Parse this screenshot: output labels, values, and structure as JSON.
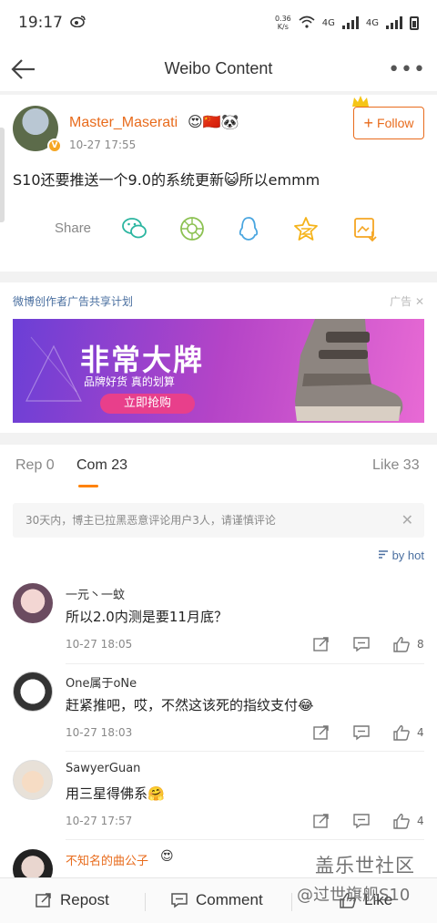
{
  "status_bar": {
    "time": "19:17",
    "speed_value": "0.36",
    "speed_unit": "K/s",
    "net_label_1": "4G",
    "net_label_2": "4G"
  },
  "header": {
    "title": "Weibo Content",
    "more": "•••"
  },
  "post": {
    "username": "Master_Maserati",
    "name_emojis": "😍🇨🇳🐼",
    "time": "10-27 17:55",
    "text": "S10还要推送一个9.0的系统更新😺所以emmm",
    "follow_label": "Follow",
    "share_label": "Share",
    "share_icons": [
      "wechat-icon",
      "moments-icon",
      "qq-icon",
      "qzone-star-icon",
      "save-image-icon"
    ]
  },
  "ad": {
    "title": "微博创作者广告共享计划",
    "label": "广告",
    "banner_big": "非常大牌",
    "banner_small": "品牌好货 真的划算",
    "banner_cta": "立即抢购"
  },
  "tabs": {
    "repost": "Rep 0",
    "comments": "Com 23",
    "likes": "Like 33"
  },
  "notice": {
    "text": "30天内，博主已拉黑恶意评论用户3人，请谨慎评论",
    "close": "✕"
  },
  "sort_label": "by hot",
  "comments": [
    {
      "name": "一元丶一蚊",
      "text": "所以2.0内测是要11月底？",
      "time": "10-27 18:05",
      "likes": "8"
    },
    {
      "name": "One属于oNe",
      "text": "赶紧推吧，哎，不然这该死的指纹支付😂",
      "time": "10-27 18:03",
      "likes": "4"
    },
    {
      "name": "SawyerGuan",
      "text": "用三星得佛系🤗",
      "time": "10-27 17:57",
      "likes": "4"
    },
    {
      "name": "不知名的曲公子",
      "name_emoji": "😍"
    }
  ],
  "bottom_bar": {
    "repost": "Repost",
    "comment": "Comment",
    "like": "Like"
  },
  "watermark": {
    "line1": "盖乐世社区",
    "line2": "@过世旗舰S10"
  },
  "colors": {
    "accent": "#e86b1c",
    "link": "#4a6fa0",
    "like_orange": "#ff8200"
  }
}
